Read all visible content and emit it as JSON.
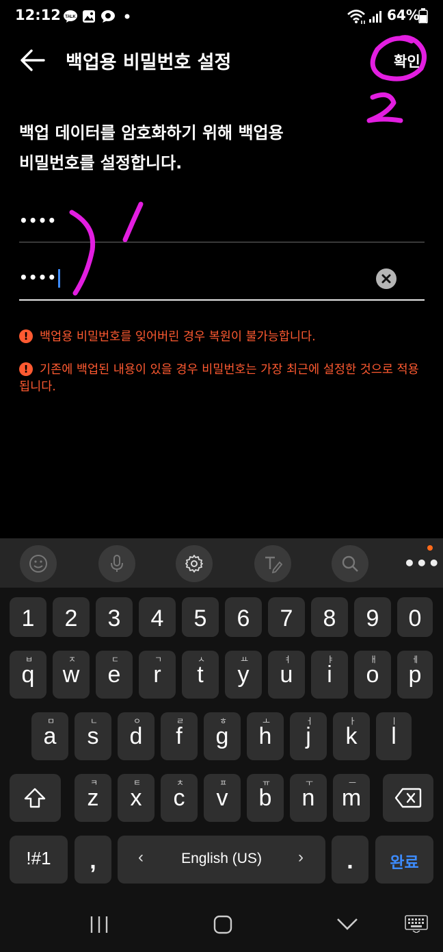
{
  "status_bar": {
    "time": "12:12",
    "battery": "64%",
    "notification_icons": [
      "kakaotalk-icon",
      "gallery-icon",
      "chat-icon",
      "dot-icon"
    ],
    "system_icons": [
      "wifi-icon",
      "signal-icon",
      "battery-icon"
    ]
  },
  "header": {
    "title": "백업용 비밀번호 설정",
    "confirm_label": "확인"
  },
  "description": "백업 데이터를 암호화하기 위해 백업용\n비밀번호를 설정합니다.",
  "fields": {
    "password_value": "••••",
    "confirm_value": "••••"
  },
  "warnings": [
    "백업용 비밀번호를 잊어버린 경우 복원이 불가능합니다.",
    "기존에 백업된 내용이 있을 경우 비밀번호는 가장 최근에 설정한 것으로 적용됩니다."
  ],
  "annotations": {
    "mark_1": "1",
    "mark_2": "2",
    "color": "#e21ee0"
  },
  "keyboard": {
    "toolbar_icons": [
      "emoji-icon",
      "microphone-icon",
      "settings-icon",
      "handwriting-icon",
      "search-icon",
      "more-icon"
    ],
    "number_row": [
      "1",
      "2",
      "3",
      "4",
      "5",
      "6",
      "7",
      "8",
      "9",
      "0"
    ],
    "row1": [
      {
        "key": "q",
        "sub": "ㅂ"
      },
      {
        "key": "w",
        "sub": "ㅈ"
      },
      {
        "key": "e",
        "sub": "ㄷ"
      },
      {
        "key": "r",
        "sub": "ㄱ"
      },
      {
        "key": "t",
        "sub": "ㅅ"
      },
      {
        "key": "y",
        "sub": "ㅛ"
      },
      {
        "key": "u",
        "sub": "ㅕ"
      },
      {
        "key": "i",
        "sub": "ㅑ"
      },
      {
        "key": "o",
        "sub": "ㅐ"
      },
      {
        "key": "p",
        "sub": "ㅔ"
      }
    ],
    "row2": [
      {
        "key": "a",
        "sub": "ㅁ"
      },
      {
        "key": "s",
        "sub": "ㄴ"
      },
      {
        "key": "d",
        "sub": "ㅇ"
      },
      {
        "key": "f",
        "sub": "ㄹ"
      },
      {
        "key": "g",
        "sub": "ㅎ"
      },
      {
        "key": "h",
        "sub": "ㅗ"
      },
      {
        "key": "j",
        "sub": "ㅓ"
      },
      {
        "key": "k",
        "sub": "ㅏ"
      },
      {
        "key": "l",
        "sub": "ㅣ"
      }
    ],
    "row3": [
      {
        "key": "z",
        "sub": "ㅋ"
      },
      {
        "key": "x",
        "sub": "ㅌ"
      },
      {
        "key": "c",
        "sub": "ㅊ"
      },
      {
        "key": "v",
        "sub": "ㅍ"
      },
      {
        "key": "b",
        "sub": "ㅠ"
      },
      {
        "key": "n",
        "sub": "ㅜ"
      },
      {
        "key": "m",
        "sub": "ㅡ"
      }
    ],
    "symbols_label": "!#1",
    "comma_label": ",",
    "space_label": "English (US)",
    "period_label": ".",
    "done_label": "완료",
    "done_color": "#3d8cff"
  },
  "nav_bar": {
    "icons": [
      "recents-icon",
      "home-icon",
      "back-chevron-icon",
      "keyboard-switch-icon"
    ]
  }
}
